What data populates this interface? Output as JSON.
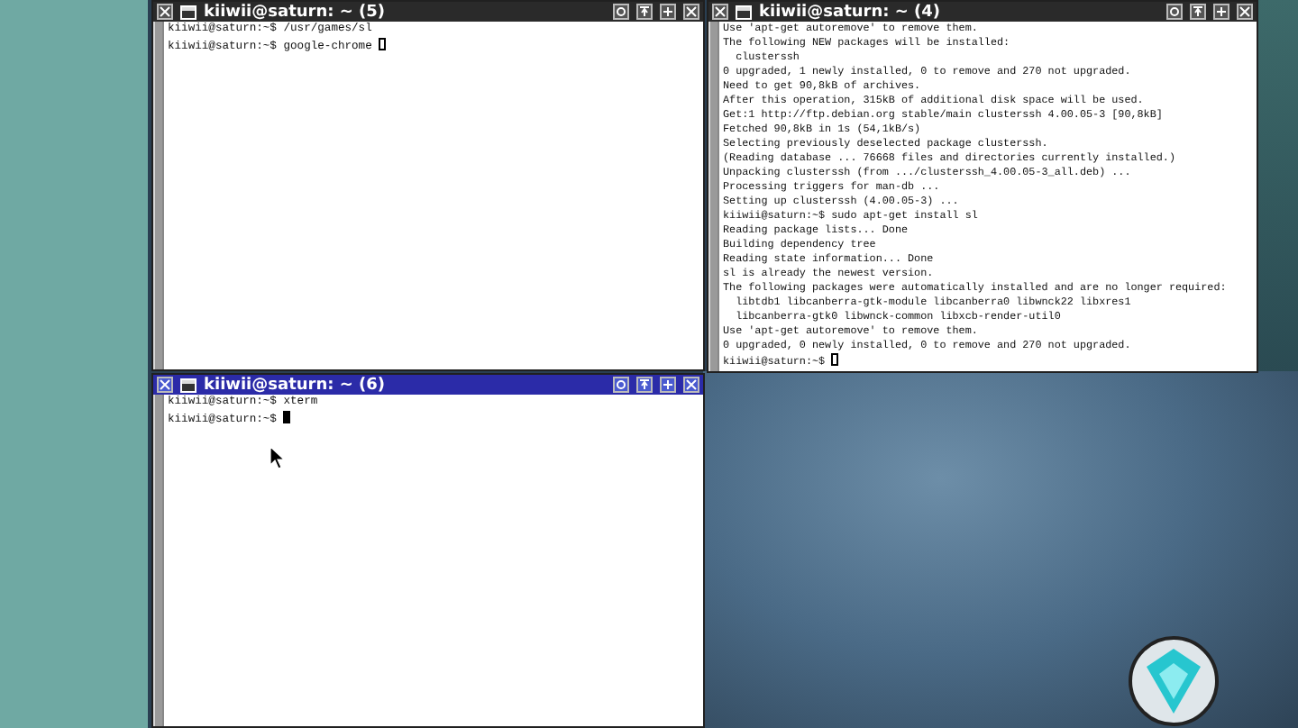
{
  "windows": [
    {
      "title": "kiiwii@saturn: ~ (5)",
      "active": false,
      "lines": [
        "kiiwii@saturn:~$ /usr/games/sl",
        "kiiwii@saturn:~$ google-chrome "
      ]
    },
    {
      "title": "kiiwii@saturn: ~ (4)",
      "active": false,
      "lines": [
        "Use 'apt-get autoremove' to remove them.",
        "The following NEW packages will be installed:",
        "  clusterssh",
        "0 upgraded, 1 newly installed, 0 to remove and 270 not upgraded.",
        "Need to get 90,8kB of archives.",
        "After this operation, 315kB of additional disk space will be used.",
        "Get:1 http://ftp.debian.org stable/main clusterssh 4.00.05-3 [90,8kB]",
        "Fetched 90,8kB in 1s (54,1kB/s)",
        "Selecting previously deselected package clusterssh.",
        "(Reading database ... 76668 files and directories currently installed.)",
        "Unpacking clusterssh (from .../clusterssh_4.00.05-3_all.deb) ...",
        "Processing triggers for man-db ...",
        "Setting up clusterssh (4.00.05-3) ...",
        "kiiwii@saturn:~$ sudo apt-get install sl",
        "Reading package lists... Done",
        "Building dependency tree",
        "Reading state information... Done",
        "sl is already the newest version.",
        "The following packages were automatically installed and are no longer required:",
        "  libtdb1 libcanberra-gtk-module libcanberra0 libwnck22 libxres1",
        "  libcanberra-gtk0 libwnck-common libxcb-render-util0",
        "Use 'apt-get autoremove' to remove them.",
        "0 upgraded, 0 newly installed, 0 to remove and 270 not upgraded.",
        "kiiwii@saturn:~$ "
      ]
    },
    {
      "title": "kiiwii@saturn: ~ (6)",
      "active": true,
      "lines": [
        "kiiwii@saturn:~$ xterm",
        "kiiwii@saturn:~$ "
      ]
    }
  ]
}
